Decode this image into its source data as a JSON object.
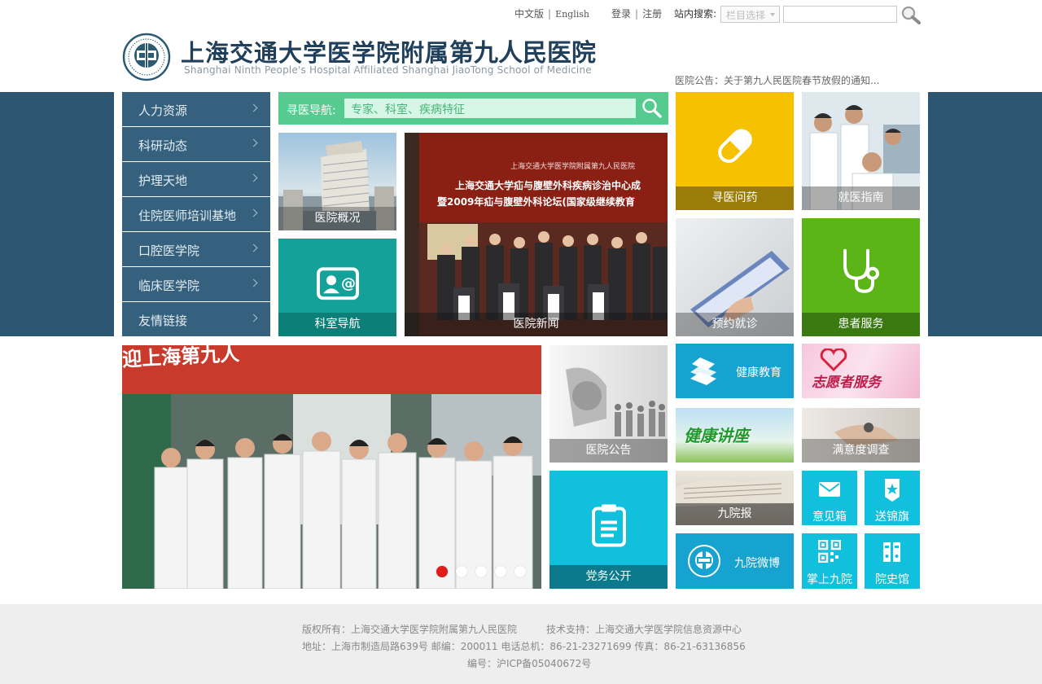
{
  "topbar": {
    "lang_cn": "中文版",
    "lang_en": "English",
    "login": "登录",
    "register": "注册",
    "search_label": "站内搜索:",
    "search_select": "栏目选择",
    "search_value": ""
  },
  "header": {
    "title_cn_a": "上海交通大学医学院附属",
    "title_cn_b": "第九人民医院",
    "title_en": "Shanghai Ninth People's Hospital Affiliated Shanghai JiaoTong School of Medicine",
    "notice": "医院公告：关于第九人民医院春节放假的通知..."
  },
  "sidebar": {
    "items": [
      {
        "label": "人力资源"
      },
      {
        "label": "科研动态"
      },
      {
        "label": "护理天地"
      },
      {
        "label": "住院医师培训基地"
      },
      {
        "label": "口腔医学院"
      },
      {
        "label": "临床医学院"
      },
      {
        "label": "友情链接"
      }
    ]
  },
  "doc_search": {
    "label": "寻医导航:",
    "placeholder": "专家、科室、疾病特征"
  },
  "tiles": {
    "overview": "医院概况",
    "department": "科室导航",
    "news": "医院新闻",
    "find_doctor": "寻医问药",
    "guide": "就医指南",
    "appointment": "预约就诊",
    "patient_service": "患者服务",
    "announcement": "医院公告",
    "party": "党务公开",
    "health_edu": "健康教育",
    "volunteer": "志愿者服务",
    "lecture": "健康讲座",
    "satisfaction": "满意度调查",
    "newspaper": "九院报",
    "suggestion": "意见箱",
    "banner": "送锦旗",
    "weibo": "九院微博",
    "mobile": "掌上九院",
    "history": "院史馆"
  },
  "news_photo": {
    "heading1": "上海交通大学医学院附属第九人民医院",
    "heading2": "上海交通大学疝与腹壁外科疾病诊治中心成",
    "heading3": "暨2009年疝与腹壁外科论坛(国家级继续教育"
  },
  "slide_photo": {
    "banner_text": "迎上海第九人",
    "slide_count": 5,
    "active_slide": 1
  },
  "footer": {
    "copyright": "版权所有：上海交通大学医学院附属第九人民医院",
    "support": "技术支持：上海交通大学医学院信息资源中心",
    "address": "地址：上海市制造局路639号  邮编：200011   电话总机：86-21-23271699   传真：86-21-63136856",
    "icp": "编号：沪ICP备05040672号"
  },
  "colors": {
    "band": "#2c5672",
    "sidebar": "#35617e",
    "green": "#55cb8f",
    "teal": "#14a19a",
    "yellow": "#f5c100",
    "leaf": "#5cb516",
    "cyan": "#11c0dd",
    "blue": "#17a3cf",
    "active_dot": "#e21b1b"
  }
}
